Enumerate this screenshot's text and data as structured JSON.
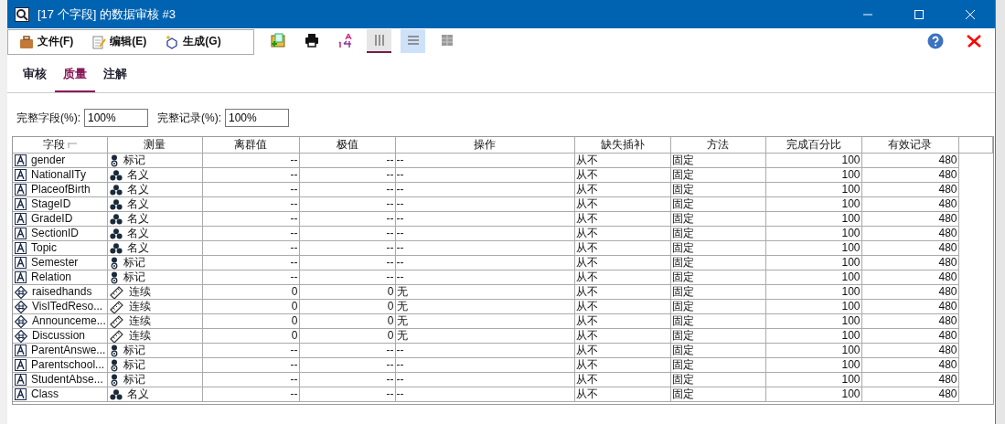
{
  "window": {
    "title": "[17 个字段] 的数据审核 #3"
  },
  "menu": [
    {
      "label": "文件(F)",
      "kind": "file"
    },
    {
      "label": "编辑(E)",
      "kind": "edit"
    },
    {
      "label": "生成(G)",
      "kind": "generate"
    }
  ],
  "toolbar": [
    {
      "kind": "add",
      "selected": false
    },
    {
      "kind": "print",
      "selected": false
    },
    {
      "kind": "sort",
      "selected": false
    },
    {
      "kind": "columns",
      "selected": true
    },
    {
      "kind": "rows",
      "selected": false
    },
    {
      "kind": "grid",
      "selected": false
    }
  ],
  "tabs": [
    {
      "label": "审核",
      "selected": false
    },
    {
      "label": "质量",
      "selected": true
    },
    {
      "label": "注解",
      "selected": false
    }
  ],
  "completeness": [
    {
      "label": "完整字段(%):",
      "value": "100%"
    },
    {
      "label": "完整记录(%):",
      "value": "100%"
    }
  ],
  "table": {
    "columns": [
      "字段",
      "测量",
      "离群值",
      "极值",
      "操作",
      "缺失插补",
      "方法",
      "完成百分比",
      "有效记录"
    ],
    "rows": [
      {
        "field": {
          "name": "gender",
          "kind": "text"
        },
        "measure": {
          "label": "标记",
          "kind": "flag"
        },
        "outliers": "--",
        "extremes": "--",
        "action": "--",
        "impute": "从不",
        "method": "固定",
        "percent": "100",
        "valid": "480"
      },
      {
        "field": {
          "name": "NationalITy",
          "kind": "text"
        },
        "measure": {
          "label": "名义",
          "kind": "nominal"
        },
        "outliers": "--",
        "extremes": "--",
        "action": "--",
        "impute": "从不",
        "method": "固定",
        "percent": "100",
        "valid": "480"
      },
      {
        "field": {
          "name": "PlaceofBirth",
          "kind": "text"
        },
        "measure": {
          "label": "名义",
          "kind": "nominal"
        },
        "outliers": "--",
        "extremes": "--",
        "action": "--",
        "impute": "从不",
        "method": "固定",
        "percent": "100",
        "valid": "480"
      },
      {
        "field": {
          "name": "StageID",
          "kind": "text"
        },
        "measure": {
          "label": "名义",
          "kind": "nominal"
        },
        "outliers": "--",
        "extremes": "--",
        "action": "--",
        "impute": "从不",
        "method": "固定",
        "percent": "100",
        "valid": "480"
      },
      {
        "field": {
          "name": "GradeID",
          "kind": "text"
        },
        "measure": {
          "label": "名义",
          "kind": "nominal"
        },
        "outliers": "--",
        "extremes": "--",
        "action": "--",
        "impute": "从不",
        "method": "固定",
        "percent": "100",
        "valid": "480"
      },
      {
        "field": {
          "name": "SectionID",
          "kind": "text"
        },
        "measure": {
          "label": "名义",
          "kind": "nominal"
        },
        "outliers": "--",
        "extremes": "--",
        "action": "--",
        "impute": "从不",
        "method": "固定",
        "percent": "100",
        "valid": "480"
      },
      {
        "field": {
          "name": "Topic",
          "kind": "text"
        },
        "measure": {
          "label": "名义",
          "kind": "nominal"
        },
        "outliers": "--",
        "extremes": "--",
        "action": "--",
        "impute": "从不",
        "method": "固定",
        "percent": "100",
        "valid": "480"
      },
      {
        "field": {
          "name": "Semester",
          "kind": "text"
        },
        "measure": {
          "label": "标记",
          "kind": "flag"
        },
        "outliers": "--",
        "extremes": "--",
        "action": "--",
        "impute": "从不",
        "method": "固定",
        "percent": "100",
        "valid": "480"
      },
      {
        "field": {
          "name": "Relation",
          "kind": "text"
        },
        "measure": {
          "label": "标记",
          "kind": "flag"
        },
        "outliers": "--",
        "extremes": "--",
        "action": "--",
        "impute": "从不",
        "method": "固定",
        "percent": "100",
        "valid": "480"
      },
      {
        "field": {
          "name": "raisedhands",
          "kind": "numeric"
        },
        "measure": {
          "label": "连续",
          "kind": "continuous"
        },
        "outliers": "0",
        "extremes": "0",
        "action": "无",
        "impute": "从不",
        "method": "固定",
        "percent": "100",
        "valid": "480"
      },
      {
        "field": {
          "name": "VisITedReso...",
          "kind": "numeric"
        },
        "measure": {
          "label": "连续",
          "kind": "continuous"
        },
        "outliers": "0",
        "extremes": "0",
        "action": "无",
        "impute": "从不",
        "method": "固定",
        "percent": "100",
        "valid": "480"
      },
      {
        "field": {
          "name": "Announceme...",
          "kind": "numeric"
        },
        "measure": {
          "label": "连续",
          "kind": "continuous"
        },
        "outliers": "0",
        "extremes": "0",
        "action": "无",
        "impute": "从不",
        "method": "固定",
        "percent": "100",
        "valid": "480"
      },
      {
        "field": {
          "name": "Discussion",
          "kind": "numeric"
        },
        "measure": {
          "label": "连续",
          "kind": "continuous"
        },
        "outliers": "0",
        "extremes": "0",
        "action": "无",
        "impute": "从不",
        "method": "固定",
        "percent": "100",
        "valid": "480"
      },
      {
        "field": {
          "name": "ParentAnswe...",
          "kind": "text"
        },
        "measure": {
          "label": "标记",
          "kind": "flag"
        },
        "outliers": "--",
        "extremes": "--",
        "action": "--",
        "impute": "从不",
        "method": "固定",
        "percent": "100",
        "valid": "480"
      },
      {
        "field": {
          "name": "Parentschool...",
          "kind": "text"
        },
        "measure": {
          "label": "标记",
          "kind": "flag"
        },
        "outliers": "--",
        "extremes": "--",
        "action": "--",
        "impute": "从不",
        "method": "固定",
        "percent": "100",
        "valid": "480"
      },
      {
        "field": {
          "name": "StudentAbse...",
          "kind": "text"
        },
        "measure": {
          "label": "标记",
          "kind": "flag"
        },
        "outliers": "--",
        "extremes": "--",
        "action": "--",
        "impute": "从不",
        "method": "固定",
        "percent": "100",
        "valid": "480"
      },
      {
        "field": {
          "name": "Class",
          "kind": "text"
        },
        "measure": {
          "label": "名义",
          "kind": "nominal"
        },
        "outliers": "--",
        "extremes": "--",
        "action": "--",
        "impute": "从不",
        "method": "固定",
        "percent": "100",
        "valid": "480"
      }
    ]
  }
}
